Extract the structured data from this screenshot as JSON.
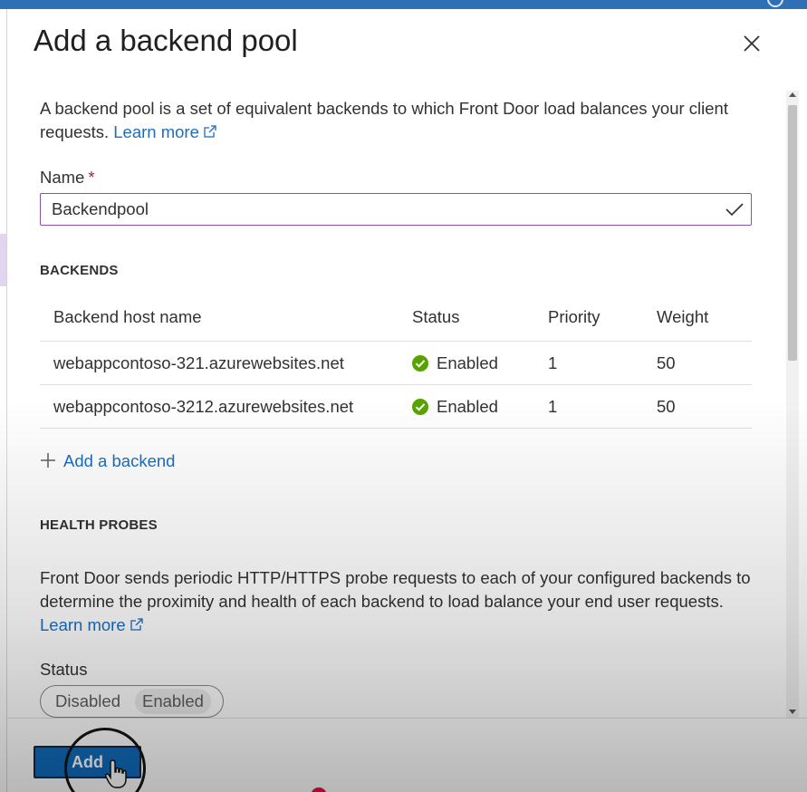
{
  "panel": {
    "title": "Add a backend pool",
    "intro_text": "A backend pool is a set of equivalent backends to which Front Door load balances your client requests.",
    "intro_link": "Learn more"
  },
  "name_field": {
    "label": "Name",
    "required_mark": "*",
    "value": "Backendpool"
  },
  "backends": {
    "heading": "BACKENDS",
    "columns": [
      "Backend host name",
      "Status",
      "Priority",
      "Weight"
    ],
    "rows": [
      {
        "host": "webappcontoso-321.azurewebsites.net",
        "status": "Enabled",
        "priority": "1",
        "weight": "50"
      },
      {
        "host": "webappcontoso-3212.azurewebsites.net",
        "status": "Enabled",
        "priority": "1",
        "weight": "50"
      }
    ],
    "add_label": "Add a backend"
  },
  "health_probes": {
    "heading": "HEALTH PROBES",
    "description": "Front Door sends periodic HTTP/HTTPS probe requests to each of your configured backends to determine the proximity and health of each backend to load balance your end user requests.",
    "learn_more": "Learn more",
    "status_label": "Status",
    "toggle_options": [
      "Disabled",
      "Enabled"
    ],
    "selected": "Enabled"
  },
  "footer": {
    "add_button": "Add"
  },
  "colors": {
    "accent": "#0f6cbd",
    "link": "#1b6ec2",
    "focus_border": "#8a4fa8",
    "success": "#57a300",
    "topbar": "#2f6fb6"
  },
  "icons": {
    "close": "close-icon",
    "external": "external-link-icon",
    "check": "checkmark-icon",
    "status": "success-check-circle-icon",
    "add": "plus-icon"
  }
}
